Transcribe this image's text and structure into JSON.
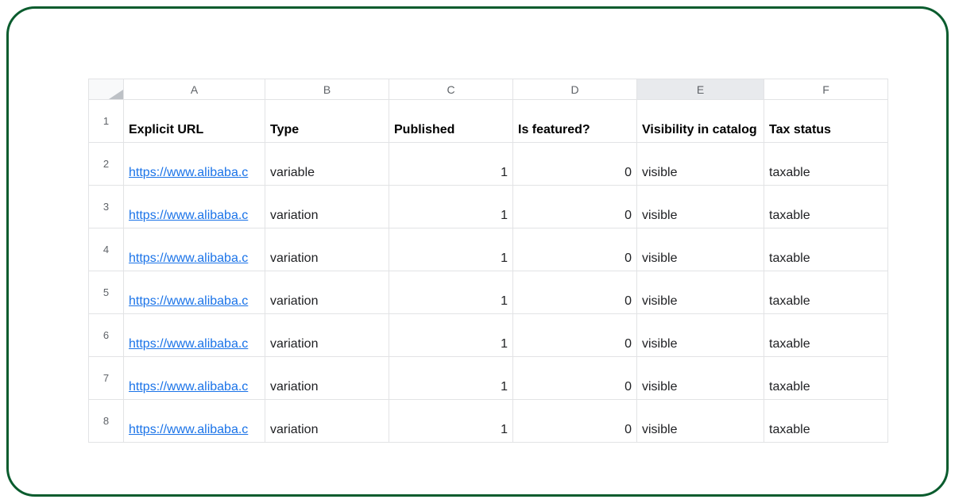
{
  "columns": [
    "A",
    "B",
    "C",
    "D",
    "E",
    "F"
  ],
  "selectedColumn": "E",
  "headers": {
    "A": "Explicit URL",
    "B": "Type",
    "C": "Published",
    "D": "Is featured?",
    "E": "Visibility in catalog",
    "F": "Tax status"
  },
  "rows": [
    {
      "num": "1"
    },
    {
      "num": "2",
      "url": "https://www.alibaba.c",
      "type": "variable",
      "published": "1",
      "featured": "0",
      "visibility": "visible",
      "tax": "taxable"
    },
    {
      "num": "3",
      "url": "https://www.alibaba.c",
      "type": "variation",
      "published": "1",
      "featured": "0",
      "visibility": "visible",
      "tax": "taxable"
    },
    {
      "num": "4",
      "url": "https://www.alibaba.c",
      "type": "variation",
      "published": "1",
      "featured": "0",
      "visibility": "visible",
      "tax": "taxable"
    },
    {
      "num": "5",
      "url": "https://www.alibaba.c",
      "type": "variation",
      "published": "1",
      "featured": "0",
      "visibility": "visible",
      "tax": "taxable"
    },
    {
      "num": "6",
      "url": "https://www.alibaba.c",
      "type": "variation",
      "published": "1",
      "featured": "0",
      "visibility": "visible",
      "tax": "taxable"
    },
    {
      "num": "7",
      "url": "https://www.alibaba.c",
      "type": "variation",
      "published": "1",
      "featured": "0",
      "visibility": "visible",
      "tax": "taxable"
    },
    {
      "num": "8",
      "url": "https://www.alibaba.c",
      "type": "variation",
      "published": "1",
      "featured": "0",
      "visibility": "visible",
      "tax": "taxable"
    }
  ]
}
